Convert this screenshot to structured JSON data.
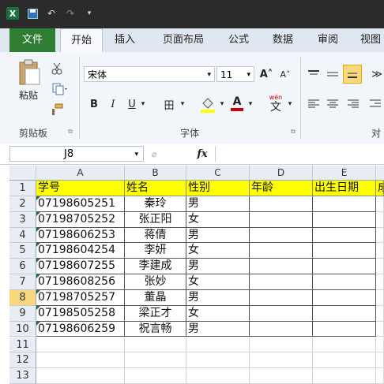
{
  "titlebar": {
    "logo": "X",
    "undo": "↶",
    "redo": "↷",
    "save": "💾",
    "qat_more": "▾"
  },
  "tabs": [
    {
      "label": "文件"
    },
    {
      "label": "开始"
    },
    {
      "label": "插入"
    },
    {
      "label": "页面布局"
    },
    {
      "label": "公式"
    },
    {
      "label": "数据"
    },
    {
      "label": "审阅"
    },
    {
      "label": "视图"
    }
  ],
  "ribbon": {
    "paste_label": "粘贴",
    "clipboard_label": "剪贴板",
    "font_group_label": "字体",
    "align_group_label": "对",
    "font_name": "宋体",
    "font_size": "11",
    "grow_font": "A˄",
    "shrink_font": "A˅",
    "bold": "B",
    "italic": "I",
    "underline": "U",
    "border": "田",
    "fill_icon": "fill-color-icon",
    "font_color": "A",
    "wen": "wén",
    "accent_yellow": "#ffff00",
    "accent_red": "#d00000"
  },
  "formula": {
    "name_box": "J8",
    "fx": "fx"
  },
  "grid": {
    "columns": [
      "A",
      "B",
      "C",
      "D",
      "E"
    ],
    "extra_column_char": "成",
    "rows": [
      "1",
      "2",
      "3",
      "4",
      "5",
      "6",
      "7",
      "8",
      "9",
      "10",
      "11",
      "12",
      "13"
    ],
    "selected_row": "8",
    "header": [
      "学号",
      "姓名",
      "性别",
      "年龄",
      "出生日期"
    ],
    "data": [
      [
        "07198605251",
        "秦玲",
        "男"
      ],
      [
        "07198705252",
        "张正阳",
        "女"
      ],
      [
        "07198606253",
        "蒋倩",
        "男"
      ],
      [
        "07198604254",
        "李妍",
        "女"
      ],
      [
        "07198607255",
        "李建成",
        "男"
      ],
      [
        "07198608256",
        "张妙",
        "女"
      ],
      [
        "07198705257",
        "董晶",
        "男"
      ],
      [
        "07198505258",
        "梁正才",
        "女"
      ],
      [
        "07198606259",
        "祝言畅",
        "男"
      ]
    ]
  }
}
